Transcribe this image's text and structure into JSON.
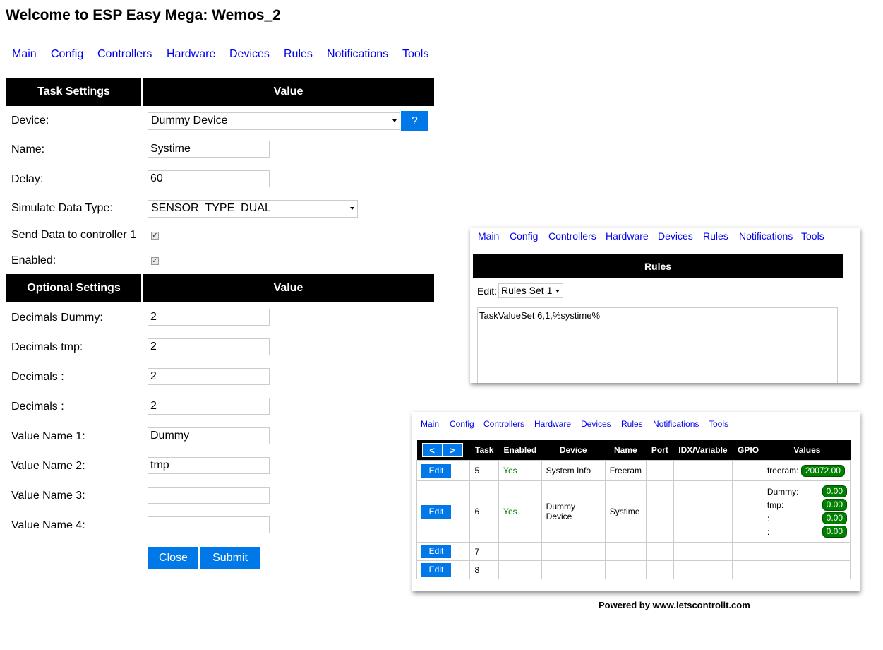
{
  "page": {
    "title": "Welcome to ESP Easy Mega: Wemos_2"
  },
  "nav": [
    "Main",
    "Config",
    "Controllers",
    "Hardware",
    "Devices",
    "Rules",
    "Notifications",
    "Tools"
  ],
  "task_settings": {
    "header_left": "Task Settings",
    "header_right": "Value",
    "device_label": "Device:",
    "device_value": "Dummy Device",
    "help_button": "?",
    "name_label": "Name:",
    "name_value": "Systime",
    "delay_label": "Delay:",
    "delay_value": "60",
    "simulate_label": "Simulate Data Type:",
    "simulate_value": "SENSOR_TYPE_DUAL",
    "send_label": "Send Data to controller 1",
    "send_checked": true,
    "enabled_label": "Enabled:",
    "enabled_checked": true
  },
  "optional_settings": {
    "header_left": "Optional Settings",
    "header_right": "Value",
    "fields": [
      {
        "label": "Decimals Dummy:",
        "value": "2"
      },
      {
        "label": "Decimals tmp:",
        "value": "2"
      },
      {
        "label": "Decimals :",
        "value": "2"
      },
      {
        "label": "Decimals :",
        "value": "2"
      },
      {
        "label": "Value Name 1:",
        "value": "Dummy"
      },
      {
        "label": "Value Name 2:",
        "value": "tmp"
      },
      {
        "label": "Value Name 3:",
        "value": ""
      },
      {
        "label": "Value Name 4:",
        "value": ""
      }
    ],
    "close_button": "Close",
    "submit_button": "Submit"
  },
  "rules_panel": {
    "header": "Rules",
    "edit_label": "Edit:",
    "rules_set": "Rules Set 1",
    "content": "TaskValueSet  6,1,%systime%"
  },
  "devices_panel": {
    "prev": "<",
    "next": ">",
    "columns": [
      "Task",
      "Enabled",
      "Device",
      "Name",
      "Port",
      "IDX/Variable",
      "GPIO",
      "Values"
    ],
    "edit_label": "Edit",
    "rows": [
      {
        "task": "5",
        "enabled": "Yes",
        "device": "System Info",
        "name": "Freeram"
      },
      {
        "task": "6",
        "enabled": "Yes",
        "device": "Dummy Device",
        "name": "Systime"
      },
      {
        "task": "7",
        "enabled": "",
        "device": "",
        "name": ""
      },
      {
        "task": "8",
        "enabled": "",
        "device": "",
        "name": ""
      }
    ],
    "values": {
      "freeram_label": "freeram:",
      "freeram_value": "20072.00",
      "dummy_label": "Dummy:",
      "dummy_value": "0.00",
      "tmp_label": "tmp:",
      "tmp_value": "0.00",
      "v3_label": ":",
      "v3_value": "0.00",
      "v4_label": ":",
      "v4_value": "0.00"
    }
  },
  "footer": "Powered by www.letscontrolit.com",
  "colors": {
    "link": "#0000ee",
    "button": "#0078e7",
    "header_bg": "#000000",
    "yes": "#008000"
  }
}
